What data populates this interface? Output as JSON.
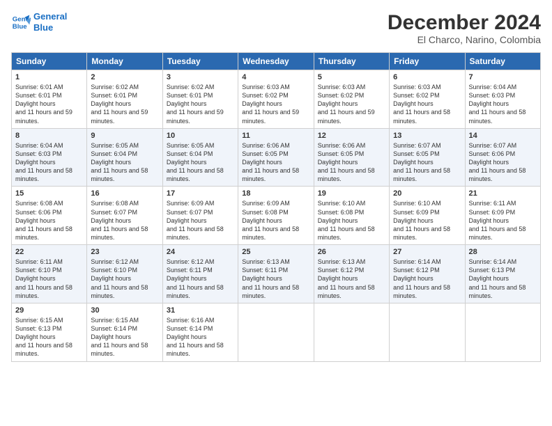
{
  "logo": {
    "line1": "General",
    "line2": "Blue"
  },
  "title": "December 2024",
  "subtitle": "El Charco, Narino, Colombia",
  "days": [
    "Sunday",
    "Monday",
    "Tuesday",
    "Wednesday",
    "Thursday",
    "Friday",
    "Saturday"
  ],
  "weeks": [
    [
      {
        "day": "1",
        "sunrise": "6:01 AM",
        "sunset": "6:01 PM",
        "daylight": "11 hours and 59 minutes."
      },
      {
        "day": "2",
        "sunrise": "6:02 AM",
        "sunset": "6:01 PM",
        "daylight": "11 hours and 59 minutes."
      },
      {
        "day": "3",
        "sunrise": "6:02 AM",
        "sunset": "6:01 PM",
        "daylight": "11 hours and 59 minutes."
      },
      {
        "day": "4",
        "sunrise": "6:03 AM",
        "sunset": "6:02 PM",
        "daylight": "11 hours and 59 minutes."
      },
      {
        "day": "5",
        "sunrise": "6:03 AM",
        "sunset": "6:02 PM",
        "daylight": "11 hours and 59 minutes."
      },
      {
        "day": "6",
        "sunrise": "6:03 AM",
        "sunset": "6:02 PM",
        "daylight": "11 hours and 58 minutes."
      },
      {
        "day": "7",
        "sunrise": "6:04 AM",
        "sunset": "6:03 PM",
        "daylight": "11 hours and 58 minutes."
      }
    ],
    [
      {
        "day": "8",
        "sunrise": "6:04 AM",
        "sunset": "6:03 PM",
        "daylight": "11 hours and 58 minutes."
      },
      {
        "day": "9",
        "sunrise": "6:05 AM",
        "sunset": "6:04 PM",
        "daylight": "11 hours and 58 minutes."
      },
      {
        "day": "10",
        "sunrise": "6:05 AM",
        "sunset": "6:04 PM",
        "daylight": "11 hours and 58 minutes."
      },
      {
        "day": "11",
        "sunrise": "6:06 AM",
        "sunset": "6:05 PM",
        "daylight": "11 hours and 58 minutes."
      },
      {
        "day": "12",
        "sunrise": "6:06 AM",
        "sunset": "6:05 PM",
        "daylight": "11 hours and 58 minutes."
      },
      {
        "day": "13",
        "sunrise": "6:07 AM",
        "sunset": "6:05 PM",
        "daylight": "11 hours and 58 minutes."
      },
      {
        "day": "14",
        "sunrise": "6:07 AM",
        "sunset": "6:06 PM",
        "daylight": "11 hours and 58 minutes."
      }
    ],
    [
      {
        "day": "15",
        "sunrise": "6:08 AM",
        "sunset": "6:06 PM",
        "daylight": "11 hours and 58 minutes."
      },
      {
        "day": "16",
        "sunrise": "6:08 AM",
        "sunset": "6:07 PM",
        "daylight": "11 hours and 58 minutes."
      },
      {
        "day": "17",
        "sunrise": "6:09 AM",
        "sunset": "6:07 PM",
        "daylight": "11 hours and 58 minutes."
      },
      {
        "day": "18",
        "sunrise": "6:09 AM",
        "sunset": "6:08 PM",
        "daylight": "11 hours and 58 minutes."
      },
      {
        "day": "19",
        "sunrise": "6:10 AM",
        "sunset": "6:08 PM",
        "daylight": "11 hours and 58 minutes."
      },
      {
        "day": "20",
        "sunrise": "6:10 AM",
        "sunset": "6:09 PM",
        "daylight": "11 hours and 58 minutes."
      },
      {
        "day": "21",
        "sunrise": "6:11 AM",
        "sunset": "6:09 PM",
        "daylight": "11 hours and 58 minutes."
      }
    ],
    [
      {
        "day": "22",
        "sunrise": "6:11 AM",
        "sunset": "6:10 PM",
        "daylight": "11 hours and 58 minutes."
      },
      {
        "day": "23",
        "sunrise": "6:12 AM",
        "sunset": "6:10 PM",
        "daylight": "11 hours and 58 minutes."
      },
      {
        "day": "24",
        "sunrise": "6:12 AM",
        "sunset": "6:11 PM",
        "daylight": "11 hours and 58 minutes."
      },
      {
        "day": "25",
        "sunrise": "6:13 AM",
        "sunset": "6:11 PM",
        "daylight": "11 hours and 58 minutes."
      },
      {
        "day": "26",
        "sunrise": "6:13 AM",
        "sunset": "6:12 PM",
        "daylight": "11 hours and 58 minutes."
      },
      {
        "day": "27",
        "sunrise": "6:14 AM",
        "sunset": "6:12 PM",
        "daylight": "11 hours and 58 minutes."
      },
      {
        "day": "28",
        "sunrise": "6:14 AM",
        "sunset": "6:13 PM",
        "daylight": "11 hours and 58 minutes."
      }
    ],
    [
      {
        "day": "29",
        "sunrise": "6:15 AM",
        "sunset": "6:13 PM",
        "daylight": "11 hours and 58 minutes."
      },
      {
        "day": "30",
        "sunrise": "6:15 AM",
        "sunset": "6:14 PM",
        "daylight": "11 hours and 58 minutes."
      },
      {
        "day": "31",
        "sunrise": "6:16 AM",
        "sunset": "6:14 PM",
        "daylight": "11 hours and 58 minutes."
      },
      null,
      null,
      null,
      null
    ]
  ]
}
